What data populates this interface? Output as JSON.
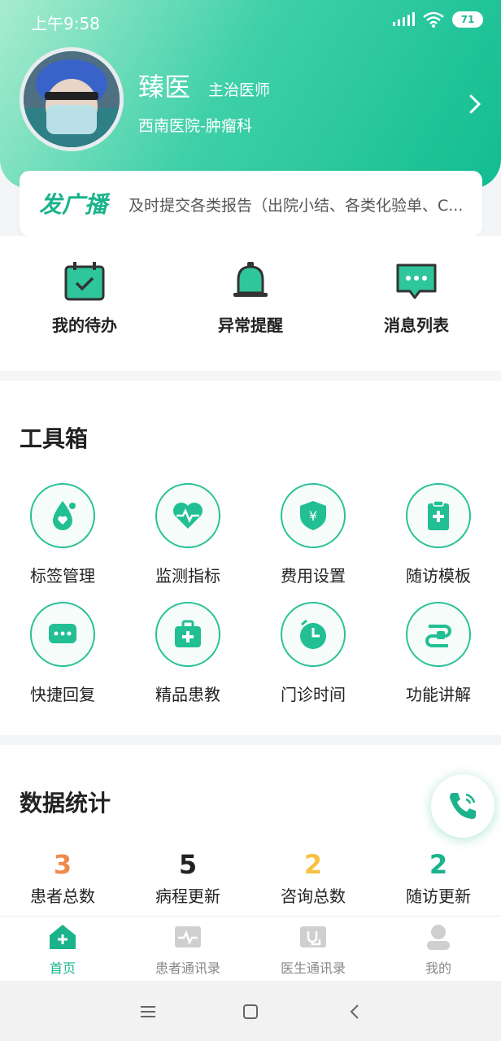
{
  "status": {
    "time": "上午9:58",
    "battery": "71"
  },
  "profile": {
    "name": "臻医",
    "title": "主治医师",
    "dept": "西南医院-肿瘤科"
  },
  "broadcast": {
    "label": "发广播",
    "text": "及时提交各类报告（出院小结、各类化验单、C..."
  },
  "quick": [
    {
      "label": "我的待办",
      "icon": "calendar-check-icon"
    },
    {
      "label": "异常提醒",
      "icon": "bell-icon"
    },
    {
      "label": "消息列表",
      "icon": "chat-bubble-icon"
    }
  ],
  "toolbox": {
    "title": "工具箱",
    "items": [
      {
        "label": "标签管理",
        "icon": "drop-heart-icon"
      },
      {
        "label": "监测指标",
        "icon": "heartbeat-icon"
      },
      {
        "label": "费用设置",
        "icon": "yuan-shield-icon"
      },
      {
        "label": "随访模板",
        "icon": "clipboard-cross-icon"
      },
      {
        "label": "快捷回复",
        "icon": "chat-dots-icon"
      },
      {
        "label": "精品患教",
        "icon": "medkit-icon"
      },
      {
        "label": "门诊时间",
        "icon": "clock-icon"
      },
      {
        "label": "功能讲解",
        "icon": "flow-icon"
      }
    ]
  },
  "stats": {
    "title": "数据统计",
    "items": [
      {
        "value": "3",
        "label": "患者总数",
        "color": "#f08a4b"
      },
      {
        "value": "5",
        "label": "病程更新",
        "color": "#222222"
      },
      {
        "value": "2",
        "label": "咨询总数",
        "color": "#f5c242"
      },
      {
        "value": "2",
        "label": "随访更新",
        "color": "#1bb38c"
      }
    ]
  },
  "tabs": [
    {
      "label": "首页",
      "icon": "home-icon",
      "active": true
    },
    {
      "label": "患者通讯录",
      "icon": "patient-book-icon",
      "active": false
    },
    {
      "label": "医生通讯录",
      "icon": "doctor-book-icon",
      "active": false
    },
    {
      "label": "我的",
      "icon": "person-icon",
      "active": false
    }
  ],
  "colors": {
    "accent": "#1bb38c",
    "accent_light": "#a8ecd0"
  }
}
